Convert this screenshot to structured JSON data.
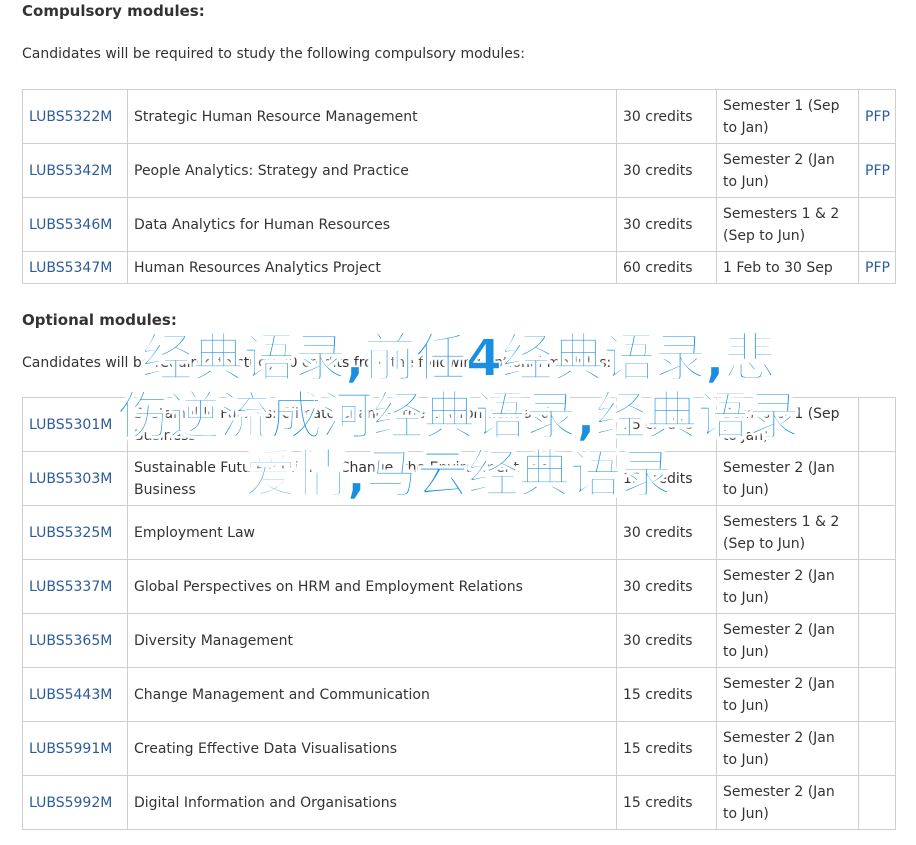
{
  "compulsory": {
    "heading": "Compulsory modules:",
    "intro": "Candidates will be required to study the following compulsory modules:",
    "rows": [
      {
        "code": "LUBS5322M",
        "title": "Strategic Human Resource Management",
        "credits": "30 credits",
        "period": "Semester 1 (Sep to Jan)",
        "pfp": "PFP"
      },
      {
        "code": "LUBS5342M",
        "title": "People Analytics: Strategy and Practice",
        "credits": "30 credits",
        "period": "Semester 2 (Jan to Jun)",
        "pfp": "PFP"
      },
      {
        "code": "LUBS5346M",
        "title": "Data Analytics for Human Resources",
        "credits": "30 credits",
        "period": "Semesters 1 & 2 (Sep to Jun)",
        "pfp": ""
      },
      {
        "code": "LUBS5347M",
        "title": "Human Resources Analytics Project",
        "credits": "60 credits",
        "period": "1 Feb to 30 Sep",
        "pfp": "PFP"
      }
    ]
  },
  "optional": {
    "heading": "Optional modules:",
    "intro": "Candidates will be required to study 30 credits from the following optional modules:",
    "rows": [
      {
        "code": "LUBS5301M",
        "title": "Sustainable Futures: Climate Change, the Environment and Business",
        "credits": "15 credits",
        "period": "Semester 1 (Sep to Jan)",
        "pfp": ""
      },
      {
        "code": "LUBS5303M",
        "title": "Sustainable Futures: Climate Change, the Environment and Business",
        "credits": "15 credits",
        "period": "Semester 2 (Jan to Jun)",
        "pfp": ""
      },
      {
        "code": "LUBS5325M",
        "title": "Employment Law",
        "credits": "30 credits",
        "period": "Semesters 1 & 2 (Sep to Jun)",
        "pfp": ""
      },
      {
        "code": "LUBS5337M",
        "title": "Global Perspectives on HRM and Employment Relations",
        "credits": "30 credits",
        "period": "Semester 2 (Jan to Jun)",
        "pfp": ""
      },
      {
        "code": "LUBS5365M",
        "title": "Diversity Management",
        "credits": "30 credits",
        "period": "Semester 2 (Jan to Jun)",
        "pfp": ""
      },
      {
        "code": "LUBS5443M",
        "title": "Change Management and Communication",
        "credits": "15 credits",
        "period": "Semester 2 (Jan to Jun)",
        "pfp": ""
      },
      {
        "code": "LUBS5991M",
        "title": "Creating Effective Data Visualisations",
        "credits": "15 credits",
        "period": "Semester 2 (Jan to Jun)",
        "pfp": ""
      },
      {
        "code": "LUBS5992M",
        "title": "Digital Information and Organisations",
        "credits": "15 credits",
        "period": "Semester 2 (Jan to Jun)",
        "pfp": ""
      }
    ]
  },
  "overlay": {
    "line1": "经典语录,前任4经典语录,悲",
    "line2": "伤逆流成河经典语录,经典语录",
    "line3": "爱情,马云经典语录"
  },
  "colors": {
    "link": "#2d5c9a",
    "text": "#333333",
    "border": "#cfcfcf",
    "overlay": "#1a8fe0"
  }
}
